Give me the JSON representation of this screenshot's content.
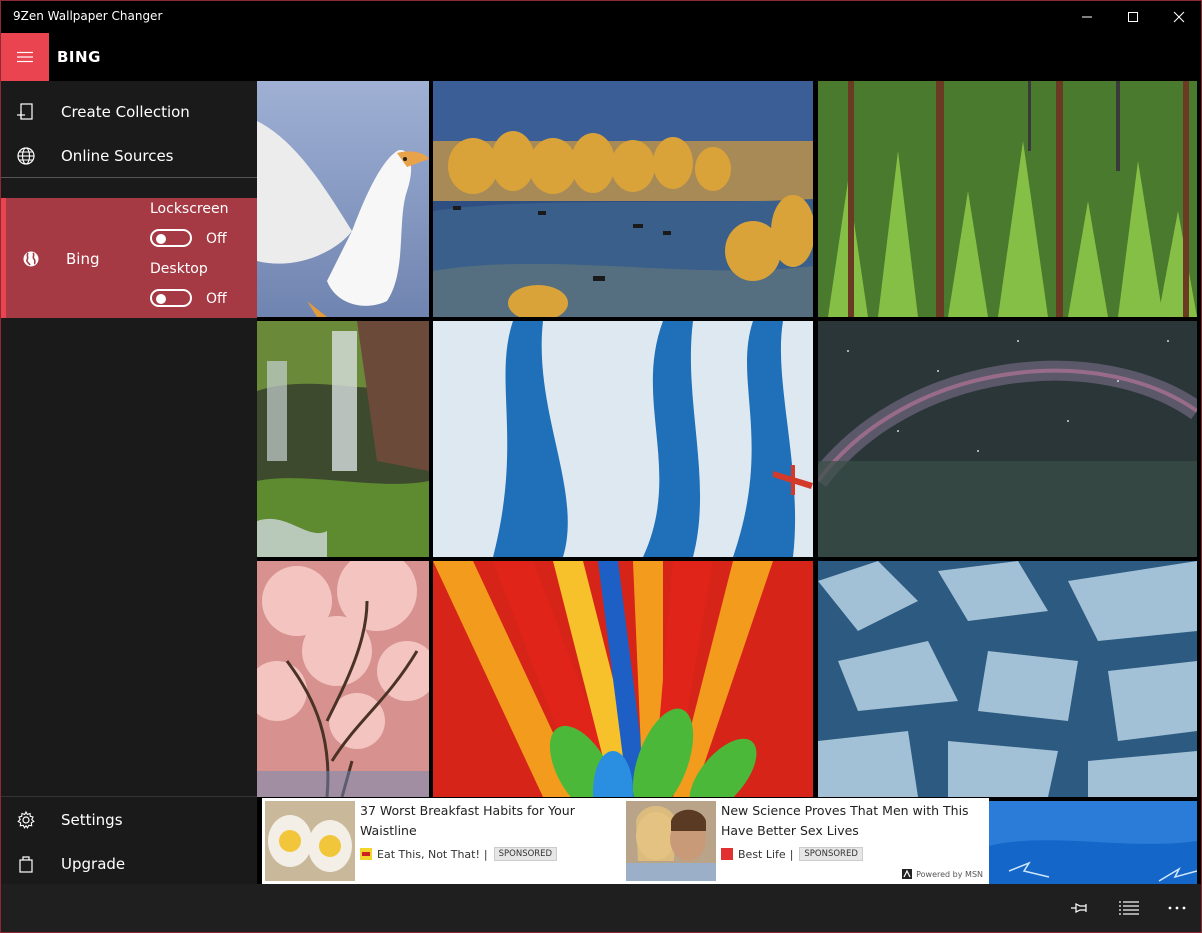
{
  "window": {
    "title": "9Zen Wallpaper Changer",
    "controls": [
      "minimize-icon",
      "maximize-icon",
      "close-icon"
    ]
  },
  "header": {
    "menu_icon": "hamburger-icon",
    "title": "BING",
    "accent_color": "#e9444f"
  },
  "sidebar": {
    "items": [
      {
        "label": "Create Collection",
        "icon": "add-collection-icon"
      },
      {
        "label": "Online Sources",
        "icon": "globe-icon"
      }
    ],
    "source": {
      "label": "Bing",
      "icon": "globe-icon",
      "selected_color": "#a63a44",
      "lockscreen": {
        "label": "Lockscreen",
        "state": "Off"
      },
      "desktop": {
        "label": "Desktop",
        "state": "Off"
      }
    },
    "bottom_items": [
      {
        "label": "Settings",
        "icon": "gear-icon"
      },
      {
        "label": "Upgrade",
        "icon": "shopping-bag-icon"
      }
    ]
  },
  "wallpapers": [
    {
      "subject": "white pelican",
      "colors": [
        "#8fa0c4",
        "#f2f2f2"
      ]
    },
    {
      "subject": "autumn trees and horses on grassland",
      "colors": [
        "#2f4f82",
        "#d5a84a"
      ]
    },
    {
      "subject": "green pine forest",
      "colors": [
        "#3f6a2a",
        "#8fc64d"
      ]
    },
    {
      "subject": "waterfall over mossy rocks",
      "colors": [
        "#3b4a30",
        "#7fae44"
      ]
    },
    {
      "subject": "blue glacier with red plane",
      "colors": [
        "#1d6fb8",
        "#dce8f2"
      ]
    },
    {
      "subject": "milky way night sky",
      "colors": [
        "#28353a",
        "#5a6a6c"
      ]
    },
    {
      "subject": "pink cherry blossom tree",
      "colors": [
        "#d98f8f",
        "#f3c2c0"
      ]
    },
    {
      "subject": "colorful feathers",
      "colors": [
        "#e2261c",
        "#f39b1d"
      ]
    },
    {
      "subject": "ice field",
      "colors": [
        "#2d5a80",
        "#b7d4e6"
      ]
    },
    {
      "subject": "lightning sky",
      "colors": [
        "#1467c8",
        "#4aa0e8"
      ]
    }
  ],
  "ads": [
    {
      "headline": "37 Worst Breakfast Habits for Your Waistline",
      "source": "Eat This, Not That!",
      "separator": "|",
      "badge": "SPONSORED"
    },
    {
      "headline": "New Science Proves That Men with This Have Better Sex Lives",
      "source": "Best Life",
      "separator": "|",
      "badge": "SPONSORED"
    }
  ],
  "ad_footer": "Powered by MSN",
  "commandbar": {
    "icons": [
      "pin-icon",
      "list-icon",
      "more-icon"
    ]
  }
}
